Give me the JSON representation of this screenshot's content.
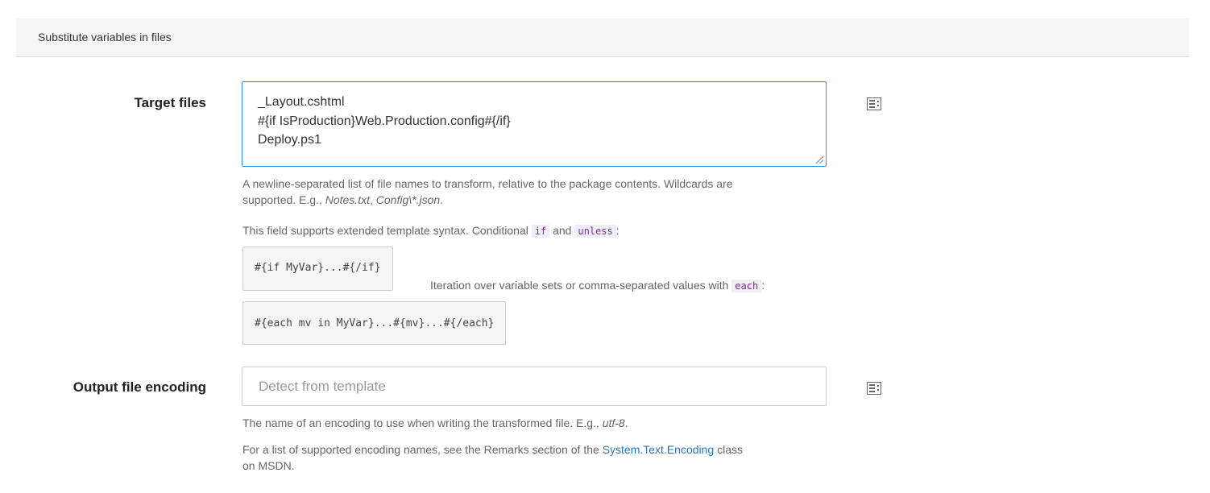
{
  "section": {
    "title": "Substitute variables in files"
  },
  "target_files": {
    "label": "Target files",
    "lines": [
      "_Layout.cshtml",
      "#{if IsProduction}Web.Production.config#{/if}",
      "Deploy.ps1"
    ],
    "help_line1_prefix": "A newline-separated list of file names to transform, relative to the package contents. Wildcards are",
    "help_line2_prefix": "supported. E.g., ",
    "help_example1": "Notes.txt",
    "help_example_sep": ", ",
    "help_example2": "Config\\*.json",
    "help_line2_suffix": ".",
    "syntax_text": "This field supports extended template syntax. Conditional ",
    "syntax_if": "if",
    "syntax_and": " and ",
    "syntax_unless": "unless",
    "syntax_colon": ":",
    "code_if": "#{if MyVar}...#{/if}",
    "iteration_text": "Iteration over variable sets or comma-separated values with ",
    "iteration_each": "each",
    "iteration_colon": ":",
    "code_each": "#{each mv in MyVar}...#{mv}...#{/each}",
    "icon": "variable-picker-icon"
  },
  "output_encoding": {
    "label": "Output file encoding",
    "placeholder": "Detect from template",
    "help1_prefix": "The name of an encoding to use when writing the transformed file. E.g., ",
    "help1_example": "utf-8",
    "help1_suffix": ".",
    "help2_prefix": "For a list of supported encoding names, see the Remarks section of the ",
    "help2_link": "System.Text.Encoding",
    "help2_suffix": " class",
    "help2_line2": "on MSDN.",
    "icon": "variable-picker-icon"
  },
  "colors": {
    "accent": "#2a8fd6",
    "link": "#2d77b6",
    "code": "#7a2e8e"
  }
}
